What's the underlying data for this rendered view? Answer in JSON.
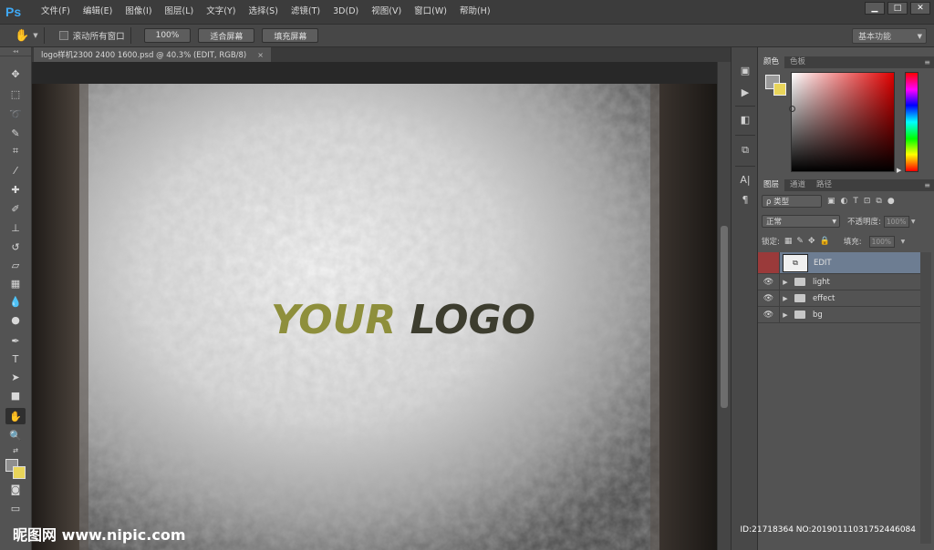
{
  "app": {
    "logo_text": "Ps"
  },
  "menu": {
    "items": [
      "文件(F)",
      "编辑(E)",
      "图像(I)",
      "图层(L)",
      "文字(Y)",
      "选择(S)",
      "滤镜(T)",
      "3D(D)",
      "视图(V)",
      "窗口(W)",
      "帮助(H)"
    ]
  },
  "window_controls": {
    "minimize": "▁",
    "maximize": "□",
    "close": "✕"
  },
  "options_bar": {
    "scroll_all_label": "滚动所有窗口",
    "zoom_100": "100%",
    "fit_screen": "适合屏幕",
    "fill_screen": "填充屏幕",
    "workspace": "基本功能"
  },
  "document": {
    "tab_title": "logo样机2300 2400 1600.psd @ 40.3% (EDIT, RGB/8)",
    "tab_close": "×",
    "logo_word1": "YOUR",
    "logo_word2": "LOGO"
  },
  "color_panel": {
    "tabs": [
      "颜色",
      "色板"
    ],
    "active_tab": 0
  },
  "layers_panel": {
    "tabs": [
      "图层",
      "通道",
      "路径"
    ],
    "kind_filter": "ρ 类型",
    "blend_mode": "正常",
    "opacity_label": "不透明度:",
    "opacity_value": "100%",
    "lock_label": "锁定:",
    "fill_label": "填充:",
    "fill_value": "100%",
    "layers": [
      {
        "name": "EDIT",
        "type": "smart-object",
        "selected": true,
        "visible": false
      },
      {
        "name": "light",
        "type": "group",
        "selected": false,
        "visible": true
      },
      {
        "name": "effect",
        "type": "group",
        "selected": false,
        "visible": true
      },
      {
        "name": "bg",
        "type": "group",
        "selected": false,
        "visible": true
      }
    ]
  },
  "watermark": {
    "left": "昵图网 www.nipic.com",
    "right": "ID:21718364 NO:20190111031752446084"
  },
  "colors": {
    "foreground": "#8e8e8e",
    "background": "#e9d55a",
    "selected_layer": "#6d7d92",
    "ps_blue": "#3fa9f5"
  }
}
